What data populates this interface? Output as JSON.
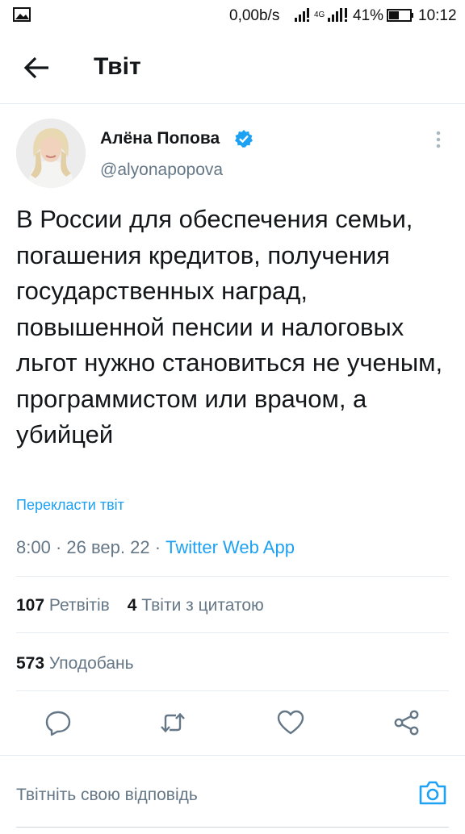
{
  "status_bar": {
    "network_speed": "0,00b/s",
    "network_type": "4G",
    "battery": "41%",
    "time": "10:12",
    "icons": [
      "gallery-icon",
      "signal-icon",
      "battery-icon"
    ]
  },
  "header": {
    "back_icon": "arrow-left-icon",
    "title": "Твіт"
  },
  "tweet": {
    "author_name": "Алёна Попова",
    "verified_icon": "verified-badge-icon",
    "handle": "@alyonapopova",
    "more_icon": "more-vertical-icon",
    "text": "В России для обеспечения семьи, погашения кредитов, получения государственных наград, повышенной пенсии и налоговых льгот нужно становиться не ученым, программистом или врачом, а убийцей",
    "translate_label": "Перекласти твіт",
    "time": "8:00",
    "date": "26 вер. 22",
    "source": "Twitter Web App",
    "separator": " · "
  },
  "stats": {
    "retweets_count": "107",
    "retweets_label": "Ретвітів",
    "quotes_count": "4",
    "quotes_label": "Твіти з цитатою",
    "likes_count": "573",
    "likes_label": "Уподобань"
  },
  "actions": {
    "icons": [
      "reply-icon",
      "retweet-icon",
      "like-icon",
      "share-icon"
    ]
  },
  "reply": {
    "placeholder": "Твітніть свою відповідь",
    "camera_icon": "camera-icon"
  },
  "colors": {
    "accent": "#1da1f2",
    "secondary_text": "#657786",
    "primary_text": "#14171a",
    "divider": "#e6ecf0"
  }
}
